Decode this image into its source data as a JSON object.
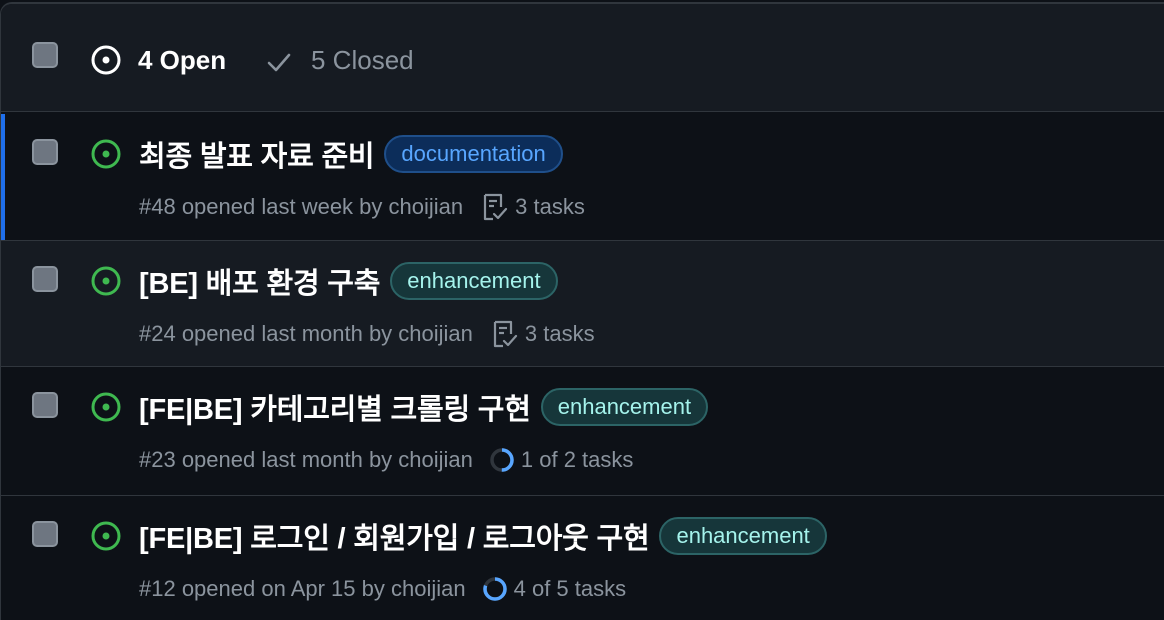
{
  "header": {
    "open_label": "4 Open",
    "closed_label": "5 Closed"
  },
  "issues": [
    {
      "title": "최종 발표 자료 준비",
      "label": "documentation",
      "meta": "#48 opened last week by choijian",
      "tasks": "3 tasks",
      "task_icon": "checklist-icon"
    },
    {
      "title": "[BE] 배포 환경 구축",
      "label": "enhancement",
      "meta": "#24 opened last month by choijian",
      "tasks": "3 tasks",
      "task_icon": "checklist-icon"
    },
    {
      "title": "[FE|BE] 카테고리별 크롤링 구현",
      "label": "enhancement",
      "meta": "#23 opened last month by choijian",
      "tasks": "1 of 2 tasks",
      "task_icon": "progress-ring-icon",
      "progress": 0.5
    },
    {
      "title": "[FE|BE] 로그인 / 회원가입 / 로그아웃 구현",
      "label": "enhancement",
      "meta": "#12 opened on Apr 15 by choijian",
      "tasks": "4 of 5 tasks",
      "task_icon": "progress-ring-icon",
      "progress": 0.8
    }
  ],
  "colors": {
    "open_green": "#3fb950",
    "accent_blue": "#1f6feb",
    "doc_label": "#58a6ff",
    "enh_label": "#a5f3ec"
  }
}
